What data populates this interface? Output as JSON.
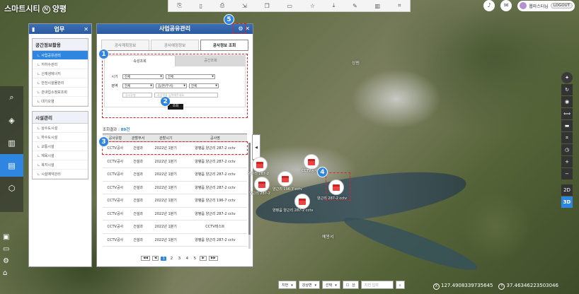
{
  "app": {
    "logo_text": "스마트시티",
    "logo_mark": "N",
    "logo_city": "양평"
  },
  "topright": {
    "user_name": "웹마스터님",
    "logout_label": "LOGOUT"
  },
  "map_labels": {
    "place1": "상원",
    "place2": "예봉서"
  },
  "menu_panel": {
    "title": "업무",
    "groups": [
      {
        "title": "공간정보활용",
        "items": [
          "사업공유관리",
          "지하수관리",
          "신재생에너지",
          "안전시설물관리",
          "관내업소정보조회",
          "대기오염"
        ]
      },
      {
        "title": "시설관리",
        "items": [
          "상수도시설",
          "하수도시설",
          "교통시설",
          "체육시설",
          "복지시설",
          "시설예약관리"
        ]
      }
    ]
  },
  "main_panel": {
    "title": "사업공유관리",
    "tabs": [
      "공사계획정보",
      "공사예정정보",
      "공사정보 조회"
    ],
    "subtabs": [
      "속성조회",
      "공간조회"
    ],
    "form": {
      "period_label": "시기",
      "period_from": "전체",
      "period_to": "전체",
      "region_label": "영역",
      "region_1": "전체",
      "region_2": "읍/면(부서)",
      "region_3": "전체",
      "input1_placeholder": "공사유형",
      "input2_placeholder": "사업명을 입력해주세요.",
      "search_label": "조회"
    },
    "count_label": "조회결과 : ",
    "count_value": "89건",
    "table": {
      "headers": [
        "공사유형",
        "관할부서",
        "관할시기",
        "공사명"
      ],
      "rows": [
        [
          "CCTV공사",
          "건설과",
          "2022년 1분기",
          "양평읍 양근리 287-2 cctv"
        ],
        [
          "CCTV공사",
          "건설과",
          "2022년 1분기",
          "양평읍 양근리 287-2 cctv"
        ],
        [
          "CCTV공사",
          "건설과",
          "2022년 1분기",
          "양평읍 양근리 287-2 cctv"
        ],
        [
          "CCTV공사",
          "건설과",
          "2022년 1분기",
          "양평읍 양근리 287-2 cctv"
        ],
        [
          "CCTV공사",
          "건설과",
          "2022년 1분기",
          "양평읍 양근리 196-7 cctv"
        ],
        [
          "CCTV공사",
          "건설과",
          "2022년 1분기",
          "양평읍 양근리 287-2 cctv"
        ],
        [
          "CCTV공사",
          "건설과",
          "2022년 1분기",
          "CCTV테스트"
        ],
        [
          "CCTV공사",
          "건설과",
          "2022년 1분기",
          "양평읍 양근리 287-2 cctv"
        ]
      ]
    },
    "pager": {
      "first": "◀◀",
      "prev": "◀",
      "pages": [
        "1",
        "2",
        "3",
        "4",
        "5"
      ],
      "current": "1",
      "next": "▶",
      "last": "▶▶"
    }
  },
  "annotations": [
    "1",
    "2",
    "3",
    "4",
    "5"
  ],
  "markers": [
    {
      "label": "양근리 287-2"
    },
    {
      "label": "CCTV공사"
    },
    {
      "label": "양근리 287-2"
    },
    {
      "label": "양근리 196-7 cctv"
    },
    {
      "label": "양평읍 양근리 287-2 cctv"
    },
    {
      "label": "양근리 287-2 cctv"
    }
  ],
  "rightbar": {
    "view_2d": "2D",
    "view_3d": "3D",
    "zoom_in": "+",
    "zoom_out": "−"
  },
  "bottombar": {
    "select1": "지번",
    "select2": "강상면",
    "select3": "선택",
    "check_label": "산",
    "input_placeholder": "지번 입력"
  },
  "coords": {
    "x_label": "X",
    "x_value": "127.4908339735645",
    "y_label": "Y",
    "y_value": "37.46346223503046"
  },
  "colors": {
    "accent": "#2e86e0",
    "header": "#2a5a9f",
    "annotation": "#e0212a"
  }
}
